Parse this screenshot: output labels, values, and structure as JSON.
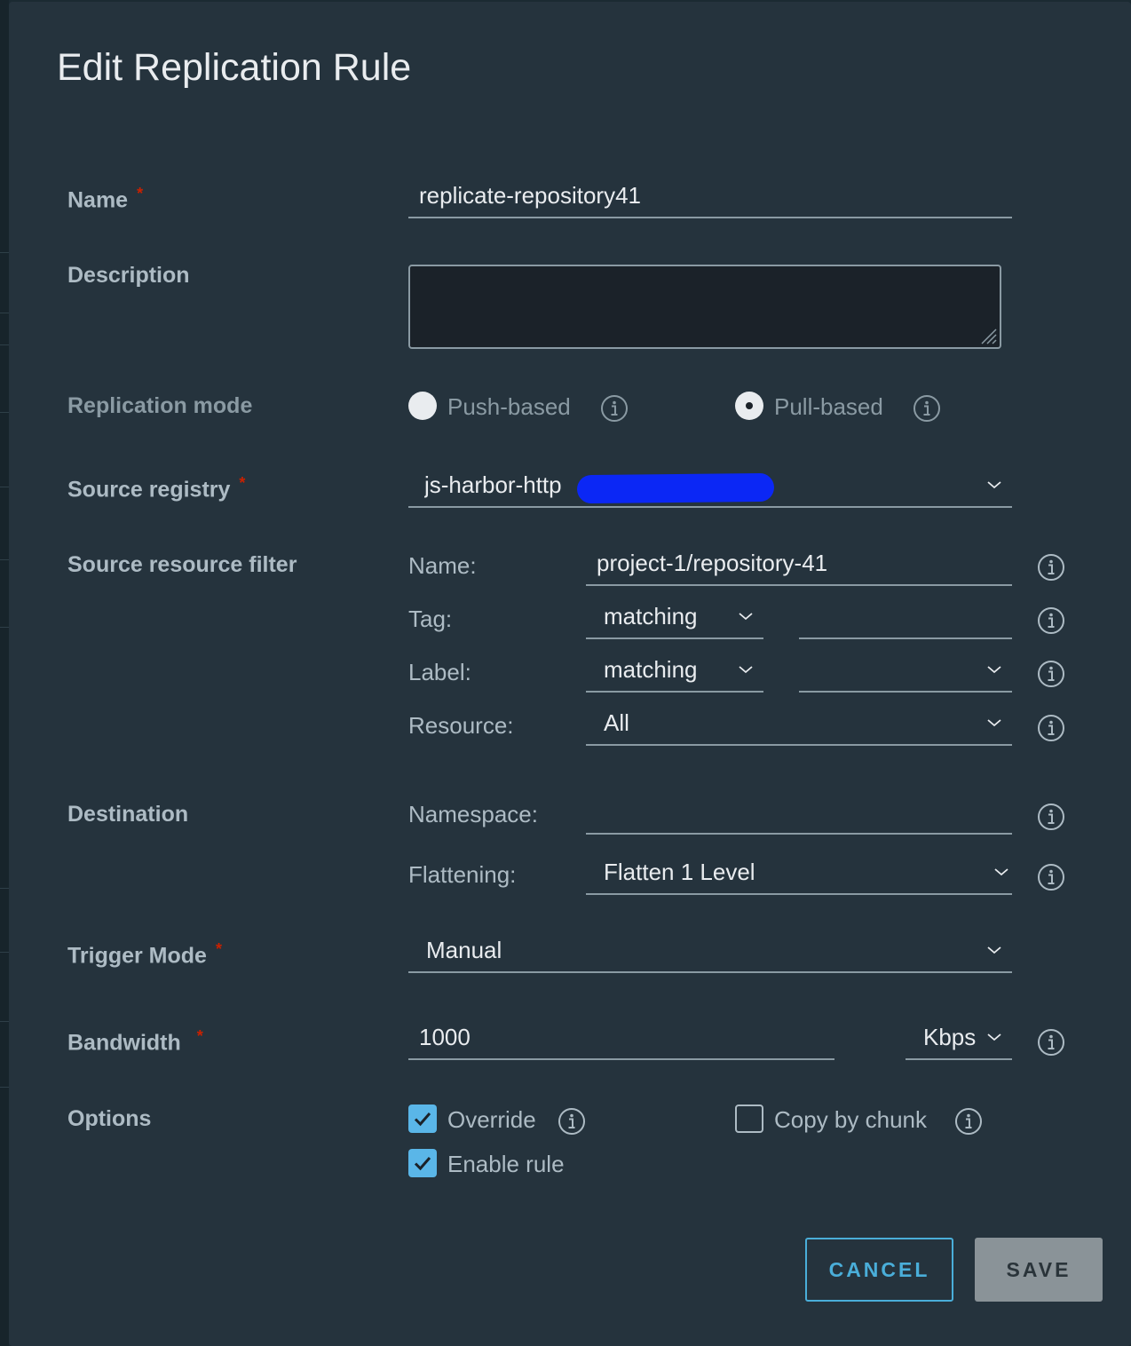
{
  "dialog": {
    "title": "Edit Replication Rule"
  },
  "form": {
    "name": {
      "label": "Name",
      "required_mark": "*",
      "value": "replicate-repository41"
    },
    "description": {
      "label": "Description",
      "value": ""
    },
    "replication_mode": {
      "label": "Replication mode",
      "options": [
        {
          "label": "Push-based",
          "selected": false
        },
        {
          "label": "Pull-based",
          "selected": true
        }
      ]
    },
    "source_registry": {
      "label": "Source registry",
      "required_mark": "*",
      "value": "js-harbor-http"
    },
    "source_resource_filter": {
      "label": "Source resource filter",
      "name": {
        "label": "Name:",
        "value": "project-1/repository-41"
      },
      "tag": {
        "label": "Tag:",
        "mode": "matching",
        "value": ""
      },
      "filter_label": {
        "label": "Label:",
        "mode": "matching",
        "value": ""
      },
      "resource": {
        "label": "Resource:",
        "value": "All"
      }
    },
    "destination": {
      "label": "Destination",
      "namespace": {
        "label": "Namespace:",
        "value": ""
      },
      "flattening": {
        "label": "Flattening:",
        "value": "Flatten 1 Level"
      }
    },
    "trigger_mode": {
      "label": "Trigger Mode",
      "required_mark": "*",
      "value": "Manual"
    },
    "bandwidth": {
      "label": "Bandwidth",
      "required_mark": "*",
      "value": "1000",
      "unit": "Kbps"
    },
    "options": {
      "label": "Options",
      "override": {
        "label": "Override",
        "checked": true
      },
      "copy_by_chunk": {
        "label": "Copy by chunk",
        "checked": false
      },
      "enable_rule": {
        "label": "Enable rule",
        "checked": true
      }
    }
  },
  "actions": {
    "cancel_label": "CANCEL",
    "save_label": "SAVE"
  },
  "colors": {
    "accent": "#5ab6e8",
    "required": "#c92100",
    "modal_bg": "#25333d",
    "redaction": "#0b27f5"
  }
}
